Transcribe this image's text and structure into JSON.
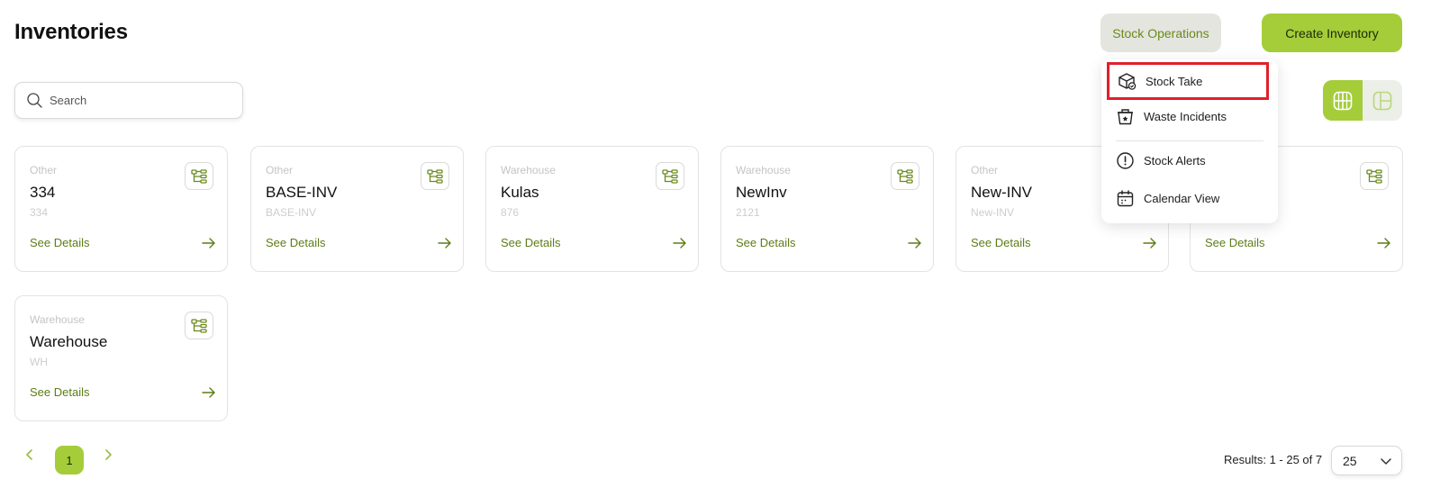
{
  "header": {
    "title": "Inventories",
    "stock_operations_label": "Stock Operations",
    "create_inventory_label": "Create Inventory"
  },
  "search": {
    "placeholder": "Search",
    "icon": "search-icon"
  },
  "view_toggle": {
    "active": "grid",
    "grid_icon": "grid-view-icon",
    "layout_icon": "layout-view-icon"
  },
  "dropdown": {
    "items": [
      {
        "label": "Stock Take",
        "icon": "box-check-icon",
        "highlighted": true
      },
      {
        "label": "Waste Incidents",
        "icon": "waste-bin-icon"
      },
      {
        "label": "Stock Alerts",
        "icon": "alert-circle-icon"
      },
      {
        "label": "Calendar View",
        "icon": "calendar-icon"
      }
    ]
  },
  "cards": [
    {
      "type": "Other",
      "name": "334",
      "code": "334",
      "link": "See Details"
    },
    {
      "type": "Other",
      "name": "BASE-INV",
      "code": "BASE-INV",
      "link": "See Details"
    },
    {
      "type": "Warehouse",
      "name": "Kulas",
      "code": "876",
      "link": "See Details"
    },
    {
      "type": "Warehouse",
      "name": "NewInv",
      "code": "2121",
      "link": "See Details"
    },
    {
      "type": "Other",
      "name": "New-INV",
      "code": "New-INV",
      "link": "See Details"
    },
    {
      "type": "",
      "name": "",
      "code": "",
      "link": "See Details"
    },
    {
      "type": "Warehouse",
      "name": "Warehouse",
      "code": "WH",
      "link": "See Details"
    }
  ],
  "pagination": {
    "current_page": "1",
    "results_text": "Results: 1 - 25 of 7",
    "per_page": "25"
  },
  "colors": {
    "accent": "#a4cd39",
    "link": "#5d7c17",
    "highlight_border": "#e0202a"
  }
}
